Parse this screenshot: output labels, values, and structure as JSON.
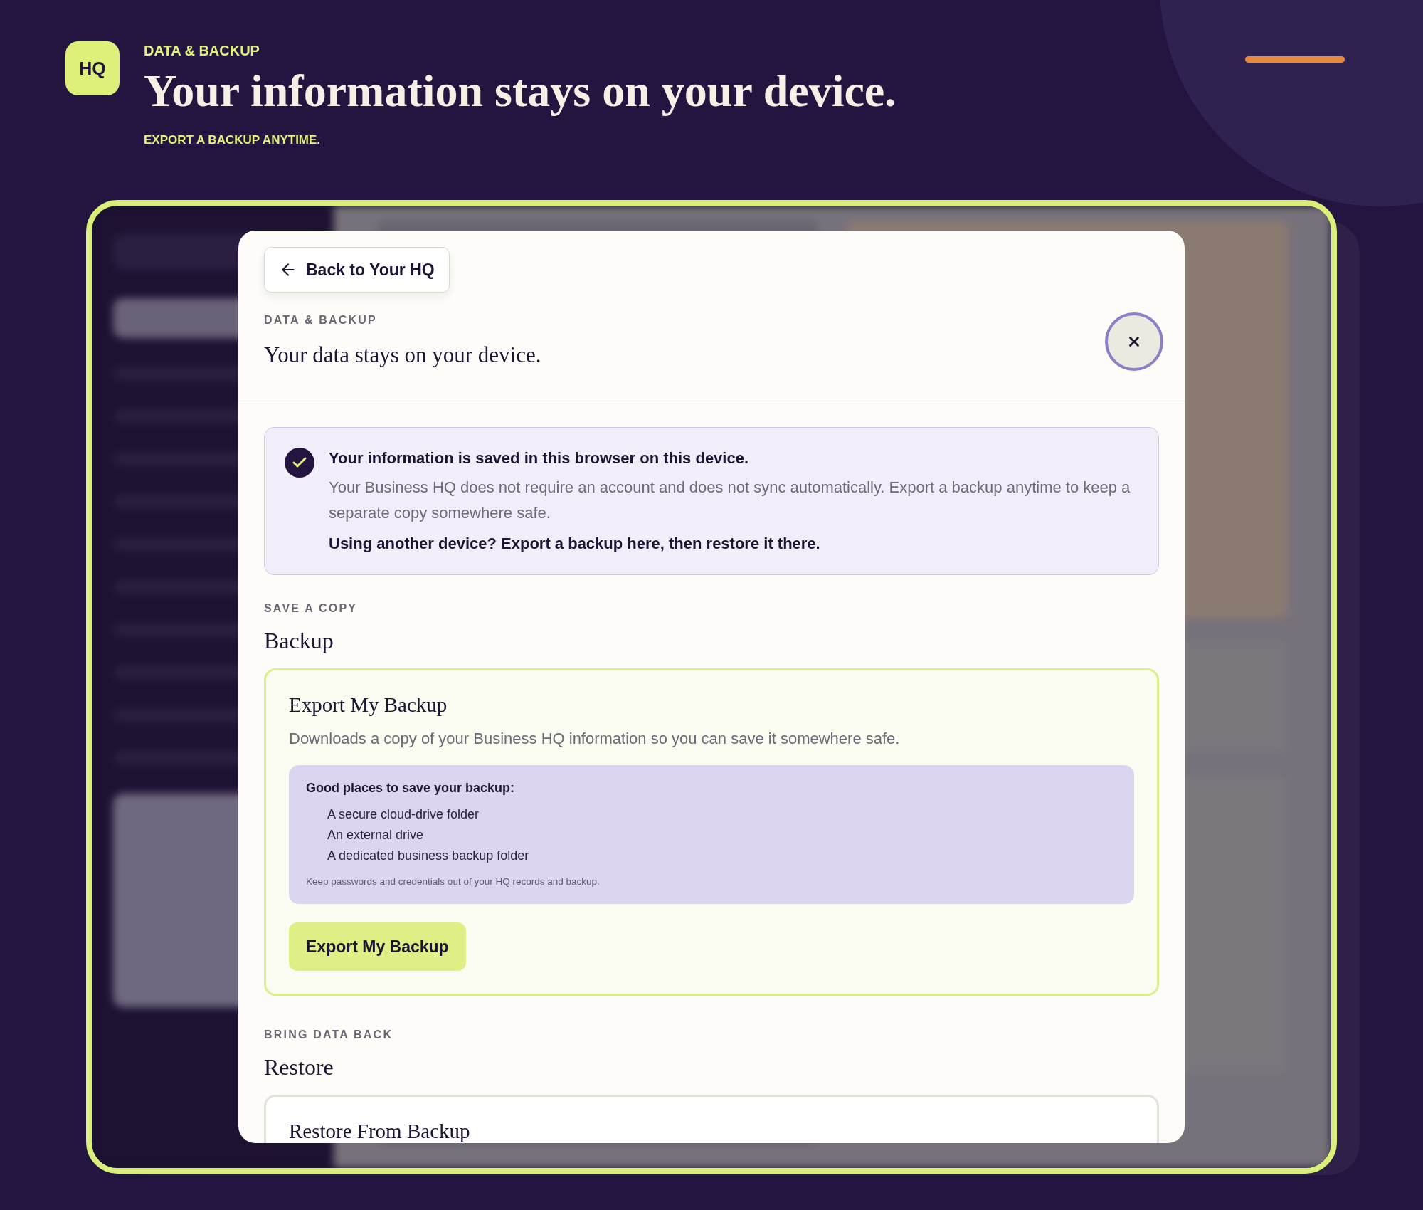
{
  "header": {
    "badge": "HQ",
    "eyebrow": "DATA & BACKUP",
    "title": "Your information stays on your device.",
    "subtitle": "EXPORT A BACKUP ANYTIME."
  },
  "modal": {
    "back_button": "Back to Your HQ",
    "eyebrow": "DATA & BACKUP",
    "title": "Your data stays on your device.",
    "notice": {
      "title": "Your information is saved in this browser on this device.",
      "body": "Your Business HQ does not require an account and does not sync automatically. Export a backup anytime to keep a separate copy somewhere safe.",
      "note": "Using another device? Export a backup here, then restore it there."
    },
    "sections": [
      {
        "eyebrow": "SAVE A COPY",
        "title": "Backup",
        "card": {
          "kind": "export",
          "title": "Export My Backup",
          "description": "Downloads a copy of your Business HQ information so you can save it somewhere safe.",
          "tips": {
            "title": "Good places to save your backup:",
            "items": [
              "A secure cloud-drive folder",
              "An external drive",
              "A dedicated business backup folder"
            ],
            "note": "Keep passwords and credentials out of your HQ records and backup."
          },
          "button": "Export My Backup"
        }
      },
      {
        "eyebrow": "BRING DATA BACK",
        "title": "Restore",
        "card": {
          "kind": "restore",
          "title": "Restore From Backup"
        }
      }
    ]
  }
}
